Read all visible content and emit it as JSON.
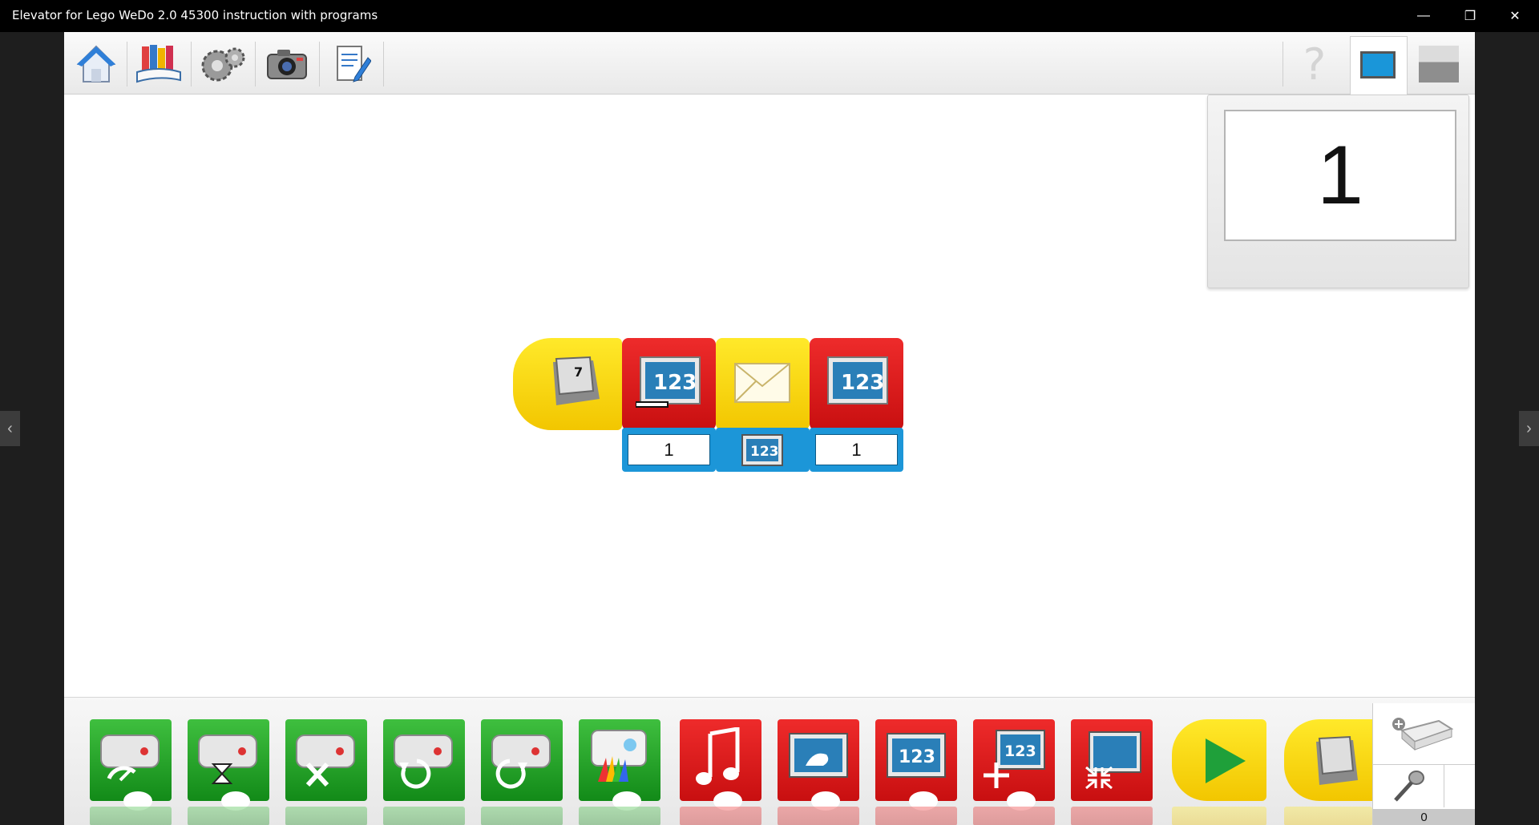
{
  "window": {
    "title": "Elevator for Lego WeDo 2.0 45300 instruction with programs",
    "minimize_glyph": "—",
    "restore_glyph": "❐",
    "close_glyph": "✕"
  },
  "toolbar": {
    "left_icons": [
      "home-icon",
      "books-icon",
      "gears-icon",
      "camera-icon",
      "document-pencil-icon"
    ],
    "right_icons": [
      "help-icon",
      "display-panel-icon",
      "gray-panel-icon"
    ],
    "help_glyph": "?"
  },
  "nav": {
    "prev_glyph": "‹",
    "next_glyph": "›"
  },
  "display": {
    "value": "1"
  },
  "program": {
    "start_block": {
      "icon": "key-icon",
      "key_label": "7"
    },
    "blocks": [
      {
        "name": "display-number-minus-block",
        "color": "red",
        "label": "123",
        "input": "1"
      },
      {
        "name": "send-message-block",
        "color": "yellow",
        "label": "",
        "input_label": "123"
      },
      {
        "name": "display-number-block",
        "color": "red",
        "label": "123",
        "input": "1"
      }
    ]
  },
  "palette": {
    "blocks": [
      {
        "name": "motor-power-block",
        "color": "green"
      },
      {
        "name": "motor-on-for-block",
        "color": "green"
      },
      {
        "name": "motor-off-block",
        "color": "green"
      },
      {
        "name": "motor-direction-left-block",
        "color": "green"
      },
      {
        "name": "motor-direction-right-block",
        "color": "green"
      },
      {
        "name": "hub-light-block",
        "color": "green"
      },
      {
        "name": "play-sound-block",
        "color": "red"
      },
      {
        "name": "display-background-block",
        "color": "red"
      },
      {
        "name": "display-number-block",
        "color": "red",
        "label": "123"
      },
      {
        "name": "add-to-display-block",
        "color": "red",
        "label": "123"
      },
      {
        "name": "display-size-block",
        "color": "red"
      },
      {
        "name": "start-block",
        "color": "yellow"
      },
      {
        "name": "start-on-key-block",
        "color": "yellow"
      }
    ],
    "device_panel": {
      "sound_level": "0"
    }
  },
  "colors": {
    "red": "#e01c1c",
    "yellow": "#fbdc14",
    "green": "#22a52a",
    "blue": "#1c96d8"
  }
}
